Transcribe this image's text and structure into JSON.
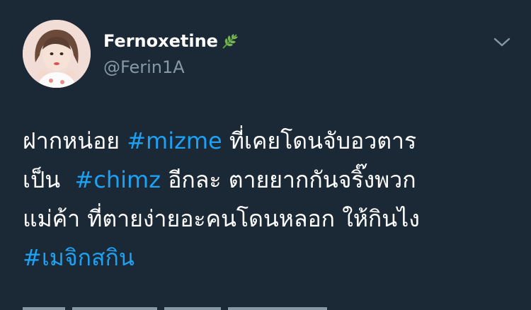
{
  "tweet": {
    "author": {
      "display_name": "Fernoxetine",
      "handle": "@Ferin1A",
      "name_emoji": "herb-icon"
    },
    "menu_icon": "chevron-down-icon",
    "text": {
      "line1_text": "ฝากหน่อย ",
      "line1_hashtag": "#mizme",
      "line1_rest": " ที่เคยโดนจับอวตาร",
      "line2_text": "เป็น  ",
      "line2_hashtag": "#chimz",
      "line2_rest": " อีกละ ตายยากกันจริ๊งพวก",
      "line3_text": "แม่ค้า ที่ตายง่ายอะคนโดนหลอก ให้กินไง",
      "line4_hashtag": "#เมจิกสกิน"
    },
    "colors": {
      "background": "#1b2836",
      "hashtag": "#1da1f2",
      "secondary": "#8899a6"
    }
  }
}
